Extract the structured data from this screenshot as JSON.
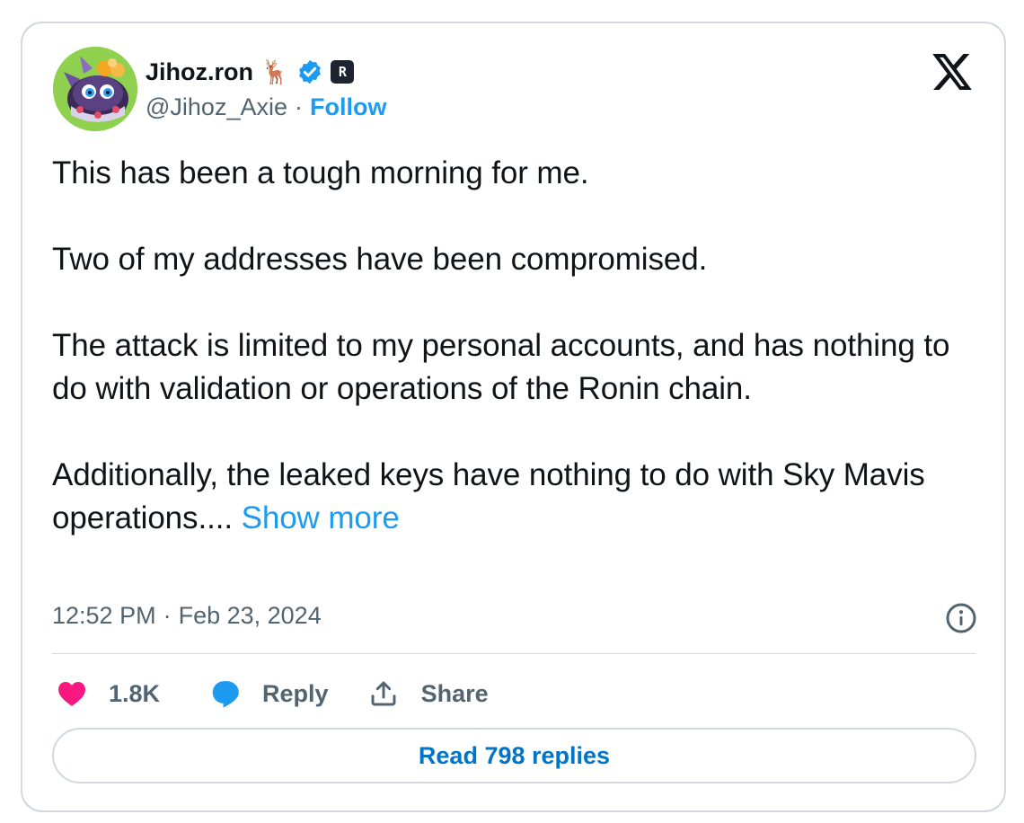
{
  "author": {
    "display_name": "Jihoz.ron",
    "name_emoji": "🦌",
    "handle": "@Jihoz_Axie",
    "separator": "·",
    "follow_label": "Follow",
    "affiliate_badge_letter": "R"
  },
  "tweet": {
    "text": "This has been a tough morning for me.\n\nTwo of my addresses have been compromised.\n\nThe attack is limited to my personal accounts, and has nothing to do with validation or operations of the Ronin chain.\n\nAdditionally, the leaked keys have nothing to do with Sky Mavis operations.... ",
    "show_more_label": "Show more",
    "time": "12:52 PM",
    "meta_separator": "·",
    "date": "Feb 23, 2024"
  },
  "actions": {
    "like_count": "1.8K",
    "reply_label": "Reply",
    "share_label": "Share"
  },
  "read_replies_label": "Read 798 replies",
  "icons": {
    "brand": "x-logo-icon",
    "verified": "verified-badge-icon",
    "info": "info-icon",
    "like": "heart-icon",
    "reply": "speech-bubble-icon",
    "share": "share-upload-icon"
  },
  "colors": {
    "accent": "#1d9bf0",
    "like": "#f91880",
    "secondary_text": "#536471",
    "border": "#cfd9de",
    "replies_link": "#0074c7"
  }
}
